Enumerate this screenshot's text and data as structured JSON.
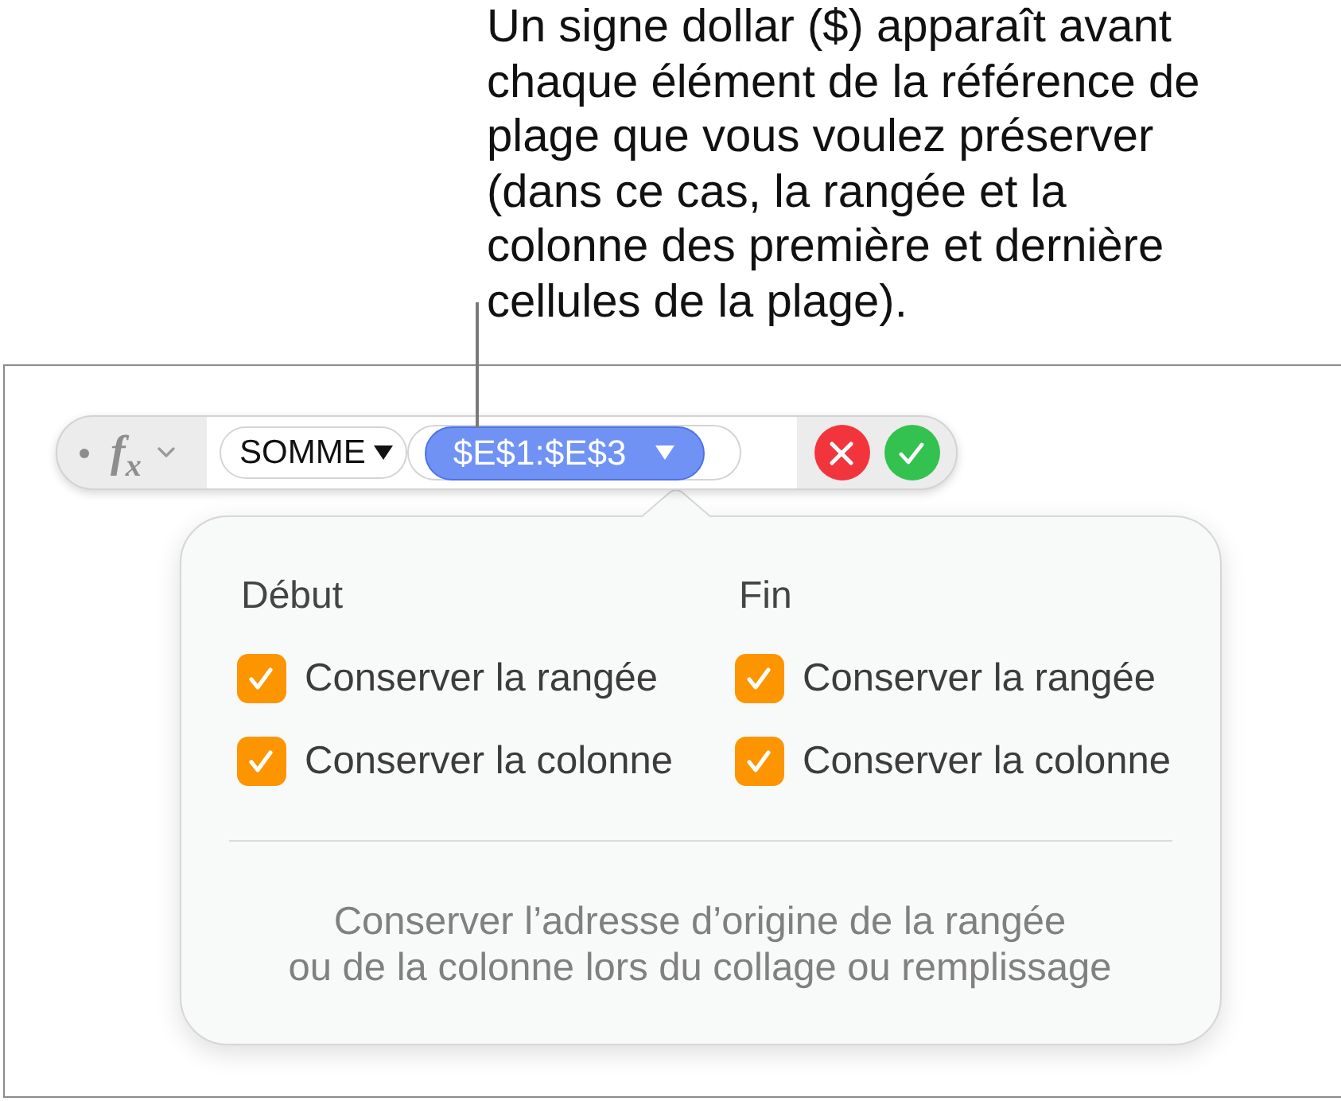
{
  "callout": {
    "text": "Un signe dollar ($) apparaît avant\nchaque élément de la référence de\nplage que vous voulez préserver\n(dans ce cas, la rangée et la\ncolonne des première et dernière\ncellules de la plage)."
  },
  "formula_bar": {
    "function_symbol": "f$_{x}$",
    "tokens": [
      {
        "kind": "function",
        "label": "SOMME",
        "selected": false
      },
      {
        "kind": "range",
        "label": "$E$1:$E$3",
        "selected": true
      }
    ]
  },
  "popover": {
    "groups": [
      {
        "heading": "Début",
        "options": [
          {
            "label": "Conserver la rangée",
            "checked": true
          },
          {
            "label": "Conserver la colonne",
            "checked": true
          }
        ]
      },
      {
        "heading": "Fin",
        "options": [
          {
            "label": "Conserver la rangée",
            "checked": true
          },
          {
            "label": "Conserver la colonne",
            "checked": true
          }
        ]
      }
    ],
    "footer": "Conserver l’adresse d’origine de la rangée\nou de la colonne lors du collage ou remplissage"
  }
}
